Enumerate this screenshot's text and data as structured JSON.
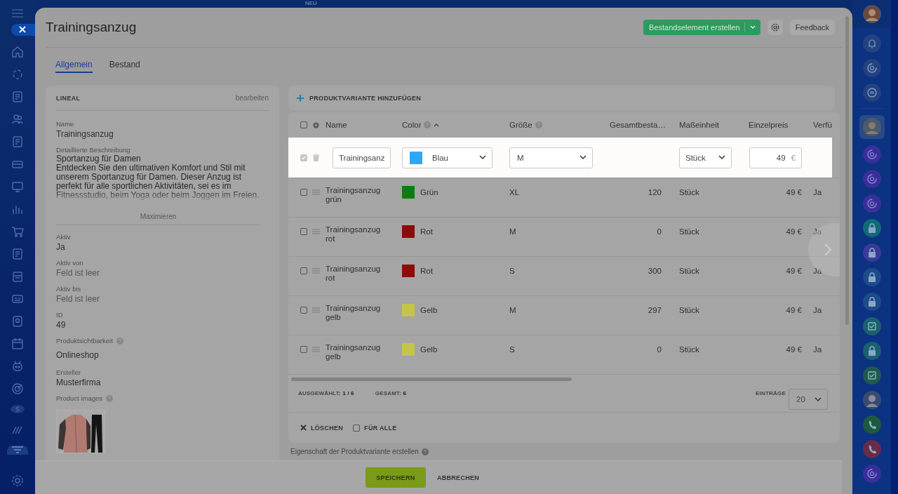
{
  "top_bar": {
    "badge": "NEU"
  },
  "left_rail": {
    "avatar_letter": "S"
  },
  "panel": {
    "title": "Trainingsanzug",
    "create_button": "Bestandselement erstellen",
    "feedback_button": "Feedback"
  },
  "tabs": [
    {
      "label": "Allgemein",
      "selected": true
    },
    {
      "label": "Bestand",
      "selected": false
    }
  ],
  "lineal": {
    "title": "LINEAL",
    "edit_link": "bearbeiten",
    "name_label": "Name",
    "name": "Trainingsanzug",
    "description_label": "Detaillierte Beschreibung",
    "description": "Sportanzug für Damen\nEntdecken Sie den ultimativen Komfort und Stil mit unserem Sportanzug für Damen. Dieser Anzug ist perfekt für alle sportlichen Aktivitäten, sei es im Fitnessstudio, beim Yoga oder beim Joggen im Freien.",
    "expand_link": "Maximieren",
    "fields": [
      {
        "label": "Aktiv",
        "value": "Ja",
        "empty": false,
        "help": false
      },
      {
        "label": "Aktiv von",
        "value": "Feld ist leer",
        "empty": true,
        "help": false
      },
      {
        "label": "Aktiv bis",
        "value": "Feld ist leer",
        "empty": true,
        "help": false
      },
      {
        "label": "ID",
        "value": "49",
        "empty": false,
        "help": false
      },
      {
        "label": "Produktsichtbarkeit",
        "value": "Onlineshop",
        "empty": false,
        "help": true
      },
      {
        "label": "Ersteller",
        "value": "Musterfirma",
        "empty": false,
        "help": false
      }
    ],
    "images_label": "Product images"
  },
  "variants": {
    "add_button": "PRODUKTVARIANTE HINZUFÜGEN",
    "columns": [
      {
        "label": "Name",
        "help": false,
        "sorted": false
      },
      {
        "label": "Color",
        "help": true,
        "sorted": true
      },
      {
        "label": "Größe",
        "help": true,
        "sorted": false
      },
      {
        "label": "Gesamtbesta…",
        "help": false,
        "sorted": false
      },
      {
        "label": "Maßeinheit",
        "help": false,
        "sorted": false
      },
      {
        "label": "Einzelpreis",
        "help": false,
        "sorted": false
      },
      {
        "label": "Verfü",
        "help": false,
        "sorted": false
      }
    ],
    "editing_row": {
      "selected": true,
      "name": "Trainingsanz",
      "color_name": "Blau",
      "color": "#2ea8f5",
      "size": "M",
      "unit": "Stück",
      "price": "49",
      "currency": "€"
    },
    "rows": [
      {
        "selected": false,
        "name": "Trainingsanzug grün",
        "color_name": "Grün",
        "color": "#0b7d0b",
        "size": "XL",
        "stock": "120",
        "unit": "Stück",
        "price": "49 €",
        "available": "Ja"
      },
      {
        "selected": false,
        "name": "Trainingsanzug rot",
        "color_name": "Rot",
        "color": "#8b0b0b",
        "size": "M",
        "stock": "0",
        "unit": "Stück",
        "price": "49 €",
        "available": "Ja"
      },
      {
        "selected": false,
        "name": "Trainingsanzug rot",
        "color_name": "Rot",
        "color": "#8b0b0b",
        "size": "S",
        "stock": "300",
        "unit": "Stück",
        "price": "49 €",
        "available": "Ja"
      },
      {
        "selected": false,
        "name": "Trainingsanzug gelb",
        "color_name": "Gelb",
        "color": "#c4c44a",
        "size": "M",
        "stock": "297",
        "unit": "Stück",
        "price": "49 €",
        "available": "Ja"
      },
      {
        "selected": false,
        "name": "Trainingsanzug gelb",
        "color_name": "Gelb",
        "color": "#c4c44a",
        "size": "S",
        "stock": "0",
        "unit": "Stück",
        "price": "49 €",
        "available": "Ja"
      }
    ],
    "summary": {
      "selected_label": "AUSGEWÄHLT:",
      "selected_value": "1 / 6",
      "total_label": "GESAMT:",
      "total_value": "6",
      "entries_label": "EINTRÄGE",
      "entries_value": "20"
    },
    "select_all_checked": false,
    "actions": {
      "delete": "LÖSCHEN",
      "for_all": "FÜR ALLE",
      "for_all_checked": false
    }
  },
  "create_property_link": "Eigenschaft der Produktvariante erstellen",
  "footer": {
    "save": "SPEICHERN",
    "cancel": "ABBRECHEN"
  }
}
